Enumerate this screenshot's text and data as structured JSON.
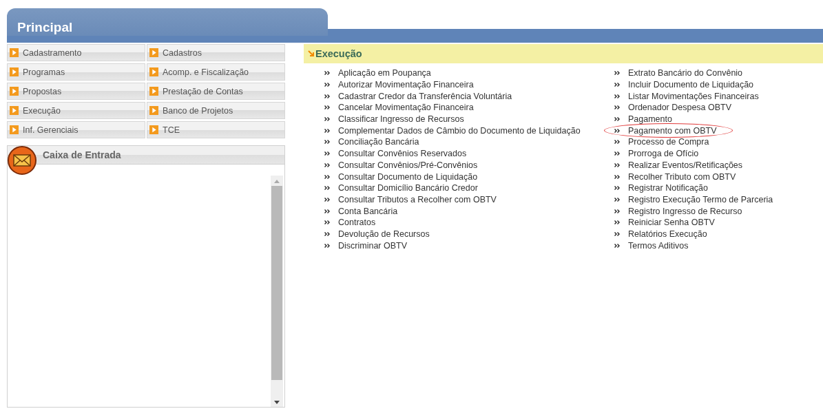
{
  "header": {
    "title": "Principal"
  },
  "menu": [
    {
      "label": "Cadastramento"
    },
    {
      "label": "Cadastros"
    },
    {
      "label": "Programas"
    },
    {
      "label": "Acomp. e Fiscalização"
    },
    {
      "label": "Propostas"
    },
    {
      "label": "Prestação de Contas"
    },
    {
      "label": "Execução"
    },
    {
      "label": "Banco de Projetos"
    },
    {
      "label": "Inf. Gerenciais"
    },
    {
      "label": "TCE"
    }
  ],
  "inbox": {
    "title": "Caixa de Entrada"
  },
  "section": {
    "title": "Execução",
    "columns": [
      [
        {
          "label": "Aplicação em Poupança",
          "highlighted": false
        },
        {
          "label": "Autorizar Movimentação Financeira",
          "highlighted": false
        },
        {
          "label": "Cadastrar Credor da Transferência Voluntária",
          "highlighted": false
        },
        {
          "label": "Cancelar Movimentação Financeira",
          "highlighted": false
        },
        {
          "label": "Classificar Ingresso de Recursos",
          "highlighted": false
        },
        {
          "label": "Complementar Dados de Câmbio do Documento de Liquidação",
          "highlighted": false
        },
        {
          "label": "Conciliação Bancária",
          "highlighted": false
        },
        {
          "label": "Consultar Convênios Reservados",
          "highlighted": false
        },
        {
          "label": "Consultar Convênios/Pré-Convênios",
          "highlighted": false
        },
        {
          "label": "Consultar Documento de Liquidação",
          "highlighted": false
        },
        {
          "label": "Consultar Domicílio Bancário Credor",
          "highlighted": false
        },
        {
          "label": "Consultar Tributos a Recolher com OBTV",
          "highlighted": false
        },
        {
          "label": "Conta Bancária",
          "highlighted": false
        },
        {
          "label": "Contratos",
          "highlighted": false
        },
        {
          "label": "Devolução de Recursos",
          "highlighted": false
        },
        {
          "label": "Discriminar OBTV",
          "highlighted": false
        }
      ],
      [
        {
          "label": "Extrato Bancário do Convênio",
          "highlighted": false
        },
        {
          "label": "Incluir Documento de Liquidação",
          "highlighted": false
        },
        {
          "label": "Listar Movimentações Financeiras",
          "highlighted": false
        },
        {
          "label": "Ordenador Despesa OBTV",
          "highlighted": false
        },
        {
          "label": "Pagamento",
          "highlighted": false
        },
        {
          "label": "Pagamento com OBTV",
          "highlighted": true
        },
        {
          "label": "Processo de Compra",
          "highlighted": false
        },
        {
          "label": "Prorroga de Ofício",
          "highlighted": false
        },
        {
          "label": "Realizar Eventos/Retificações",
          "highlighted": false
        },
        {
          "label": "Recolher Tributo com OBTV",
          "highlighted": false
        },
        {
          "label": "Registrar Notificação",
          "highlighted": false
        },
        {
          "label": "Registro Execução Termo de Parceria",
          "highlighted": false
        },
        {
          "label": "Registro Ingresso de Recurso",
          "highlighted": false
        },
        {
          "label": "Reiniciar Senha OBTV",
          "highlighted": false
        },
        {
          "label": "Relatórios Execução",
          "highlighted": false
        },
        {
          "label": "Termos Aditivos",
          "highlighted": false
        }
      ]
    ]
  }
}
